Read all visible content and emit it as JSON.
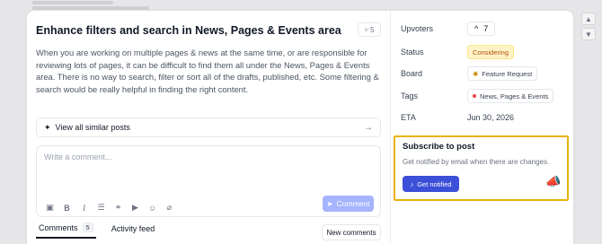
{
  "post": {
    "title": "Enhance filters and search in News, Pages & Events area",
    "comment_count_badge": "5",
    "description": "When you are working on multiple pages & news at the same time, or are responsible for reviewing lots of pages, it can be difficult to find them all under the News, Pages & Events area. There is no way to search, filter or sort all of the drafts, published, etc. Some filtering & search would be really helpful in finding the right content."
  },
  "similar_posts": {
    "label": "View all similar posts"
  },
  "comment_box": {
    "placeholder": "Write a comment...",
    "submit_label": "Comment",
    "toolbar_icons": [
      "image-icon",
      "bold-icon",
      "italic-icon",
      "list-icon",
      "link-icon",
      "video-icon",
      "emoji-icon",
      "attachment-icon"
    ]
  },
  "tabs": {
    "comments_label": "Comments",
    "comments_count": "5",
    "activity_label": "Activity feed",
    "new_comments_label": "New comments"
  },
  "sidebar": {
    "upvoters": {
      "label": "Upvoters",
      "count": "7"
    },
    "status": {
      "label": "Status",
      "value": "Considering"
    },
    "board": {
      "label": "Board",
      "value": "Feature Request"
    },
    "tags": {
      "label": "Tags",
      "value": "News, Pages & Events"
    },
    "eta": {
      "label": "ETA",
      "value": "Jun 30, 2026"
    }
  },
  "subscribe": {
    "title": "Subscribe to post",
    "description": "Get notified by email when there are changes.",
    "button_label": "Get notified"
  },
  "colors": {
    "accent": "#3b4fd8",
    "comment_button": "#a5b4fc",
    "status_bg": "#fef3c7",
    "status_text": "#b45309",
    "highlight_border": "#eab308",
    "tag_dot": "#ef4444"
  }
}
